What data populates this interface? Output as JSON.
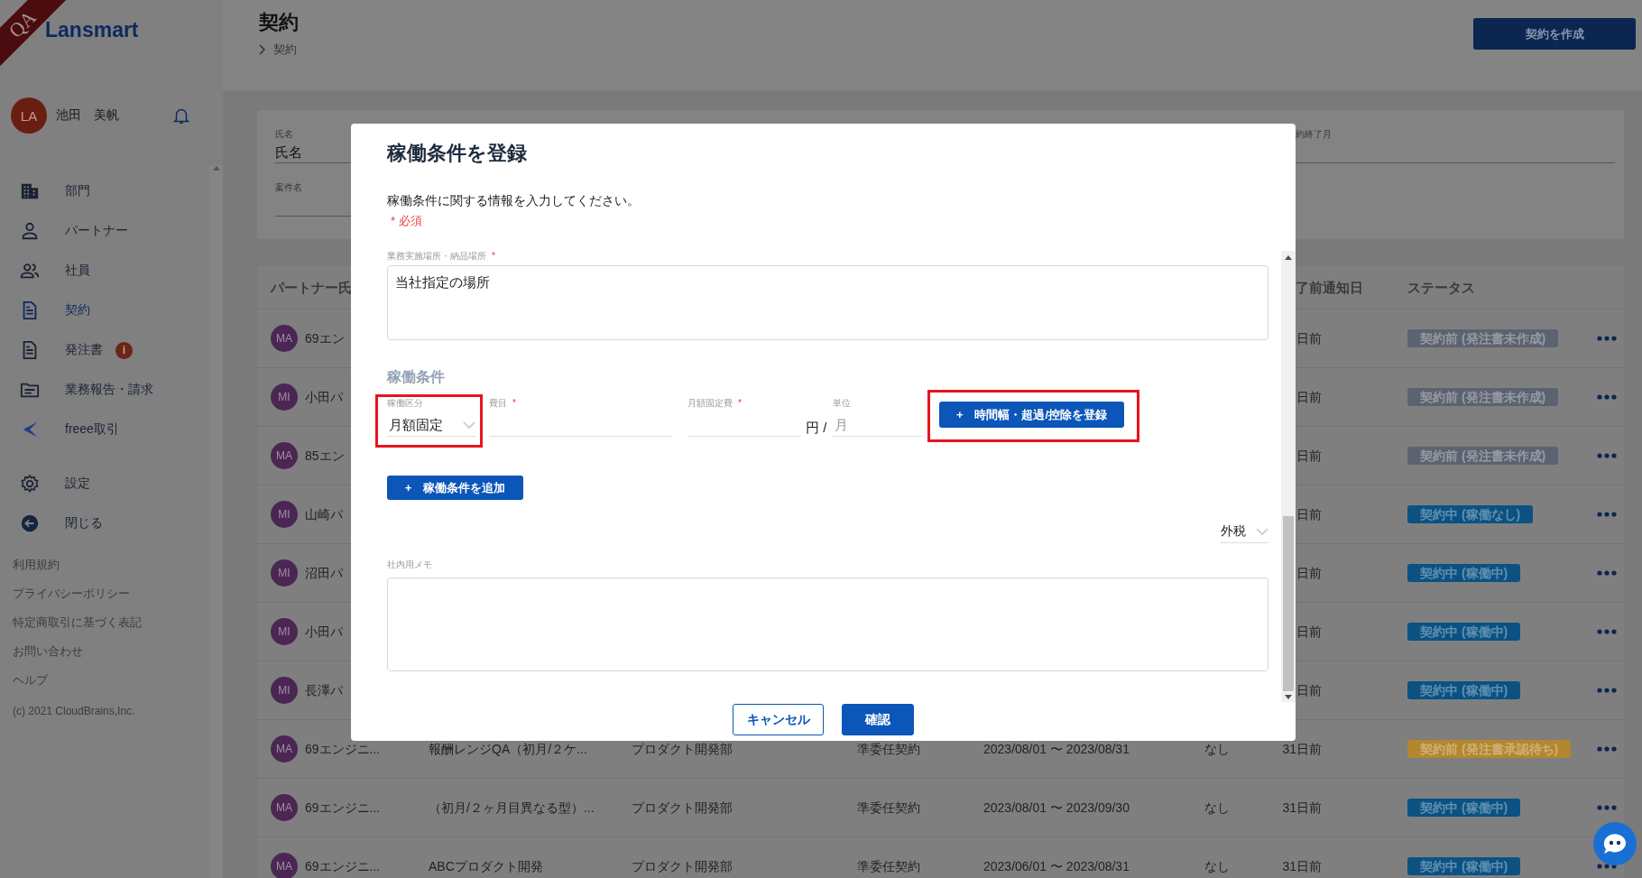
{
  "ribbon": {
    "label": "QA"
  },
  "logo": {
    "text": "Lansmart"
  },
  "user": {
    "initials": "LA",
    "name": "池田　美帆"
  },
  "nav": [
    {
      "label": "部門",
      "kind": "building",
      "selected": false
    },
    {
      "label": "パートナー",
      "kind": "person",
      "selected": false
    },
    {
      "label": "社員",
      "kind": "people",
      "selected": false
    },
    {
      "label": "契約",
      "kind": "document",
      "selected": true
    },
    {
      "label": "発注書",
      "kind": "document",
      "selected": false,
      "badge": "i"
    },
    {
      "label": "業務報告・請求",
      "kind": "folder",
      "selected": false
    },
    {
      "label": "freee取引",
      "kind": "swoosh",
      "selected": false
    }
  ],
  "nav_bottom": [
    {
      "label": "設定",
      "kind": "gear",
      "selected": false
    },
    {
      "label": "閉じる",
      "kind": "back",
      "selected": false
    }
  ],
  "footer_links": [
    "利用規約",
    "プライバシーポリシー",
    "特定商取引に基づく表記",
    "お問い合わせ",
    "ヘルプ"
  ],
  "copyright": "(c) 2021 CloudBrains,Inc.",
  "header": {
    "title": "契約",
    "breadcrumb": "契約",
    "create_button": "契約を作成"
  },
  "filters": {
    "name": {
      "label": "氏名",
      "placeholder": "氏名"
    },
    "project": {
      "label": "案件名"
    },
    "end_month": {
      "label": "約終了月"
    }
  },
  "table": {
    "columns": [
      {
        "label": "パートナー氏"
      },
      {
        "label": "了前通知日"
      },
      {
        "label": "ステータス"
      }
    ],
    "rows": [
      {
        "initials": "MA",
        "partner": "69エン",
        "notice": "日前",
        "status": "契約前 (発注書未作成)",
        "color": "#5c6370"
      },
      {
        "initials": "MI",
        "partner": "小田パ",
        "notice": "日前",
        "status": "契約前 (発注書未作成)",
        "color": "#5c6370"
      },
      {
        "initials": "MA",
        "partner": "85エン",
        "notice": "日前",
        "status": "契約前 (発注書未作成)",
        "color": "#5c6370"
      },
      {
        "initials": "MI",
        "partner": "山崎パ",
        "notice": "日前",
        "status": "契約中 (稼働なし)",
        "color": "#0b5283"
      },
      {
        "initials": "MI",
        "partner": "沼田パ",
        "notice": "日前",
        "status": "契約中 (稼働中)",
        "color": "#0b5283"
      },
      {
        "initials": "MI",
        "partner": "小田パ",
        "notice": "日前",
        "status": "契約中 (稼働中)",
        "color": "#0b5283"
      },
      {
        "initials": "MI",
        "partner": "長澤パ",
        "notice": "日前",
        "status": "契約中 (稼働中)",
        "color": "#0b5283"
      },
      {
        "initials": "MA",
        "partner": "69エンジニ...",
        "project": "報酬レンジQA（初月/２ケ...",
        "department": "プロダクト開発部",
        "contract_type": "準委任契約",
        "period": "2023/08/01 〜 2023/08/31",
        "column_7": "なし",
        "notice": "31日前",
        "status": "契約前 (発注書承認待ち)",
        "color": "#b4862f"
      },
      {
        "initials": "MA",
        "partner": "69エンジニ...",
        "project": "（初月/２ヶ月目異なる型）...",
        "department": "プロダクト開発部",
        "contract_type": "準委任契約",
        "period": "2023/08/01 〜 2023/09/30",
        "column_7": "なし",
        "notice": "31日前",
        "status": "契約中 (稼働中)",
        "color": "#0b5283"
      },
      {
        "initials": "MA",
        "partner": "69エンジニ...",
        "project": "ABCプロダクト開発",
        "department": "プロダクト開発部",
        "contract_type": "準委任契約",
        "period": "2023/06/01 〜 2023/08/31",
        "column_7": "なし",
        "notice": "31日前",
        "status": "契約中 (稼働中)",
        "color": "#0b5283"
      }
    ]
  },
  "modal": {
    "title": "稼働条件を登録",
    "description": "稼働条件に関する情報を入力してください。",
    "required_note": "* 必須",
    "location": {
      "label": "業務実施場所・納品場所",
      "mark": "*",
      "value": "当社指定の場所"
    },
    "section_title": "稼働条件",
    "conditions": [
      {
        "kind": "select",
        "label": "稼働区分",
        "value": "月額固定",
        "highlighted": true
      },
      {
        "kind": "text",
        "label": "費目",
        "mark": "*"
      },
      {
        "kind": "text",
        "label": "月額固定費",
        "mark": "*",
        "suffix": "円 /"
      },
      {
        "kind": "text",
        "label": "単位",
        "value": "月",
        "disabled": true
      }
    ],
    "time_button": {
      "label": "+　時間幅・超過/控除を登録",
      "highlighted": true
    },
    "add_button": "+　稼働条件を追加",
    "tax_select": {
      "value": "外税"
    },
    "memo": {
      "label": "社内用メモ"
    },
    "buttons": [
      {
        "label": "キャンセル",
        "kind": "outline"
      },
      {
        "label": "確認",
        "kind": "primary"
      }
    ]
  }
}
